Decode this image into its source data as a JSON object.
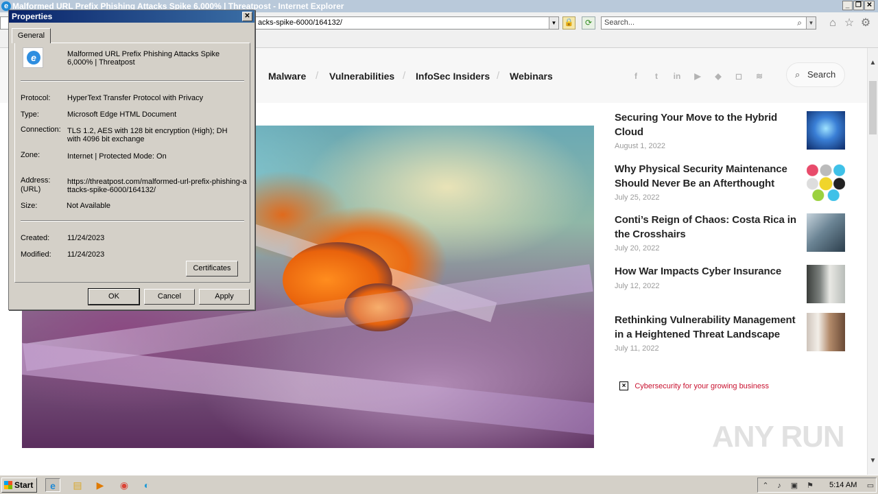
{
  "window": {
    "title": "Malformed URL Prefix Phishing Attacks Spike 6,000% | Threatpost - Internet Explorer"
  },
  "address_bar": {
    "url_visible": "acks-spike-6000/164132/",
    "search_placeholder": "Search..."
  },
  "site": {
    "nav": [
      "Malware",
      "Vulnerabilities",
      "InfoSec Insiders",
      "Webinars"
    ],
    "nav_separator": "/",
    "social_icons": [
      "facebook-icon",
      "twitter-icon",
      "linkedin-icon",
      "youtube-icon",
      "feedly-icon",
      "instagram-icon",
      "rss-icon"
    ],
    "search_label": "Search"
  },
  "articles": [
    {
      "title": "Securing Your Move to the Hybrid Cloud",
      "date": "August 1, 2022"
    },
    {
      "title": "Why Physical Security Maintenance Should Never Be an Afterthought",
      "date": "July 25, 2022"
    },
    {
      "title": "Conti’s Reign of Chaos: Costa Rica in the Crosshairs",
      "date": "July 20, 2022"
    },
    {
      "title": "How War Impacts Cyber Insurance",
      "date": "July 12, 2022"
    },
    {
      "title": "Rethinking Vulnerability Management in a Heightened Threat Landscape",
      "date": "July 11, 2022"
    }
  ],
  "ad": {
    "text": "Cybersecurity for your growing business"
  },
  "watermark": "ANY RUN",
  "dialog": {
    "title": "Properties",
    "tab": "General",
    "page_name": "Malformed URL Prefix Phishing Attacks Spike 6,000% | Threatpost",
    "protocol_label": "Protocol:",
    "protocol": "HyperText Transfer Protocol with Privacy",
    "type_label": "Type:",
    "type": "Microsoft Edge HTML Document",
    "connection_label": "Connection:",
    "connection": "TLS 1.2, AES with 128 bit encryption (High); DH with 4096 bit exchange",
    "zone_label": "Zone:",
    "zone": "Internet | Protected Mode: On",
    "address_label": "Address:",
    "address_label2": "(URL)",
    "address": "https://threatpost.com/malformed-url-prefix-phishing-attacks-spike-6000/164132/",
    "size_label": "Size:",
    "size": "Not Available",
    "created_label": "Created:",
    "created": "11/24/2023",
    "modified_label": "Modified:",
    "modified": "11/24/2023",
    "certificates_button": "Certificates",
    "ok_button": "OK",
    "cancel_button": "Cancel",
    "apply_button": "Apply"
  },
  "taskbar": {
    "start_label": "Start",
    "clock": "5:14 AM"
  }
}
